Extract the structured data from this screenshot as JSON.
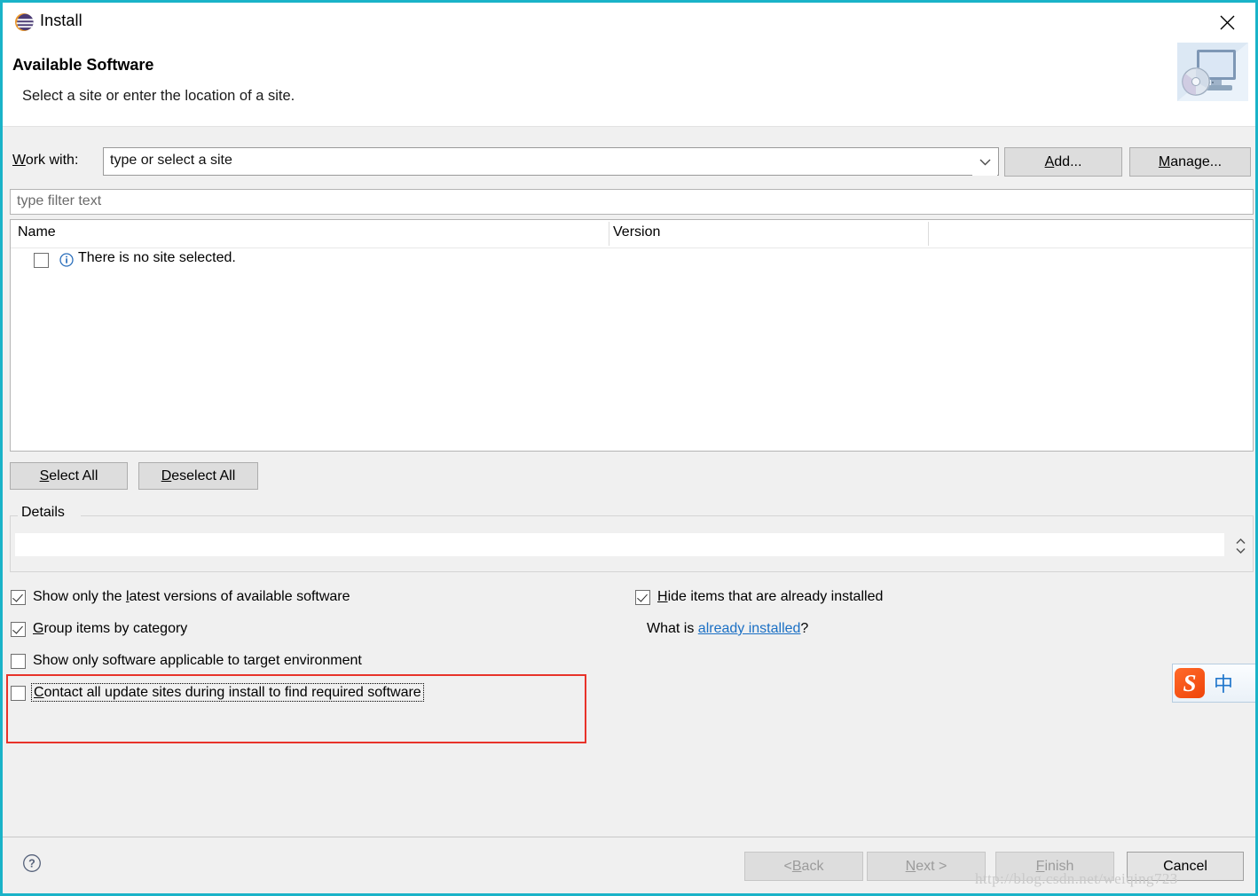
{
  "window": {
    "title": "Install",
    "icon": "eclipse-sphere-icon",
    "close_label": "✕",
    "border_color": "#1ab3c8"
  },
  "header": {
    "title": "Available Software",
    "subtitle": "Select a site or enter the location of a site.",
    "art_icon": "monitor-with-cd-icon"
  },
  "work_with": {
    "label_prefix": "W",
    "label_rest": "ork with:",
    "value": "type or select a site",
    "dropdown_icon": "chevron-down-icon",
    "add_button": {
      "mnemonic": "A",
      "rest": "dd..."
    },
    "manage_button": {
      "mnemonic": "M",
      "rest": "anage..."
    }
  },
  "filter": {
    "placeholder": "type filter text",
    "value": ""
  },
  "table": {
    "columns": [
      "Name",
      "Version"
    ],
    "rows": [
      {
        "checked": false,
        "icon": "info-circle-icon",
        "name": "There is no site selected.",
        "version": ""
      }
    ]
  },
  "list_buttons": {
    "select_all": {
      "mnemonic": "S",
      "rest": "elect All"
    },
    "deselect_all": {
      "mnemonic": "D",
      "rest": "eselect All"
    }
  },
  "details": {
    "legend": "Details",
    "value": "",
    "spinner_icon": "spinner-up-down-icon"
  },
  "options": {
    "show_latest": {
      "checked": true,
      "pre": "Show only the ",
      "mnemonic": "l",
      "post": "atest versions of available software"
    },
    "group_by_category": {
      "checked": true,
      "pre": "",
      "mnemonic": "G",
      "post": "roup items by category"
    },
    "target_environment": {
      "checked": false,
      "pre": "",
      "mnemonic": "S",
      "post": "how only software applicable to target environment"
    },
    "contact_all_sites": {
      "checked": false,
      "pre": "",
      "mnemonic": "C",
      "post": "ontact all update sites during install to find required software",
      "focused": true,
      "highlight_color": "#e8332a"
    },
    "hide_installed": {
      "checked": true,
      "pre": "",
      "mnemonic": "H",
      "post": "ide items that are already installed"
    }
  },
  "what_is": {
    "prefix": "What is ",
    "link": "already installed",
    "suffix": "?",
    "link_color": "#1a6fc4"
  },
  "ime": {
    "logo_letter": "S",
    "mode": "中"
  },
  "footer": {
    "help_icon": "question-circle-icon",
    "back": {
      "pre": "< ",
      "mnemonic": "B",
      "post": "ack"
    },
    "next": {
      "pre": "",
      "mnemonic": "N",
      "post": "ext >"
    },
    "finish": {
      "pre": "",
      "mnemonic": "F",
      "post": "inish"
    },
    "cancel": "Cancel",
    "watermark": "http://blog.csdn.net/weiqing723"
  }
}
